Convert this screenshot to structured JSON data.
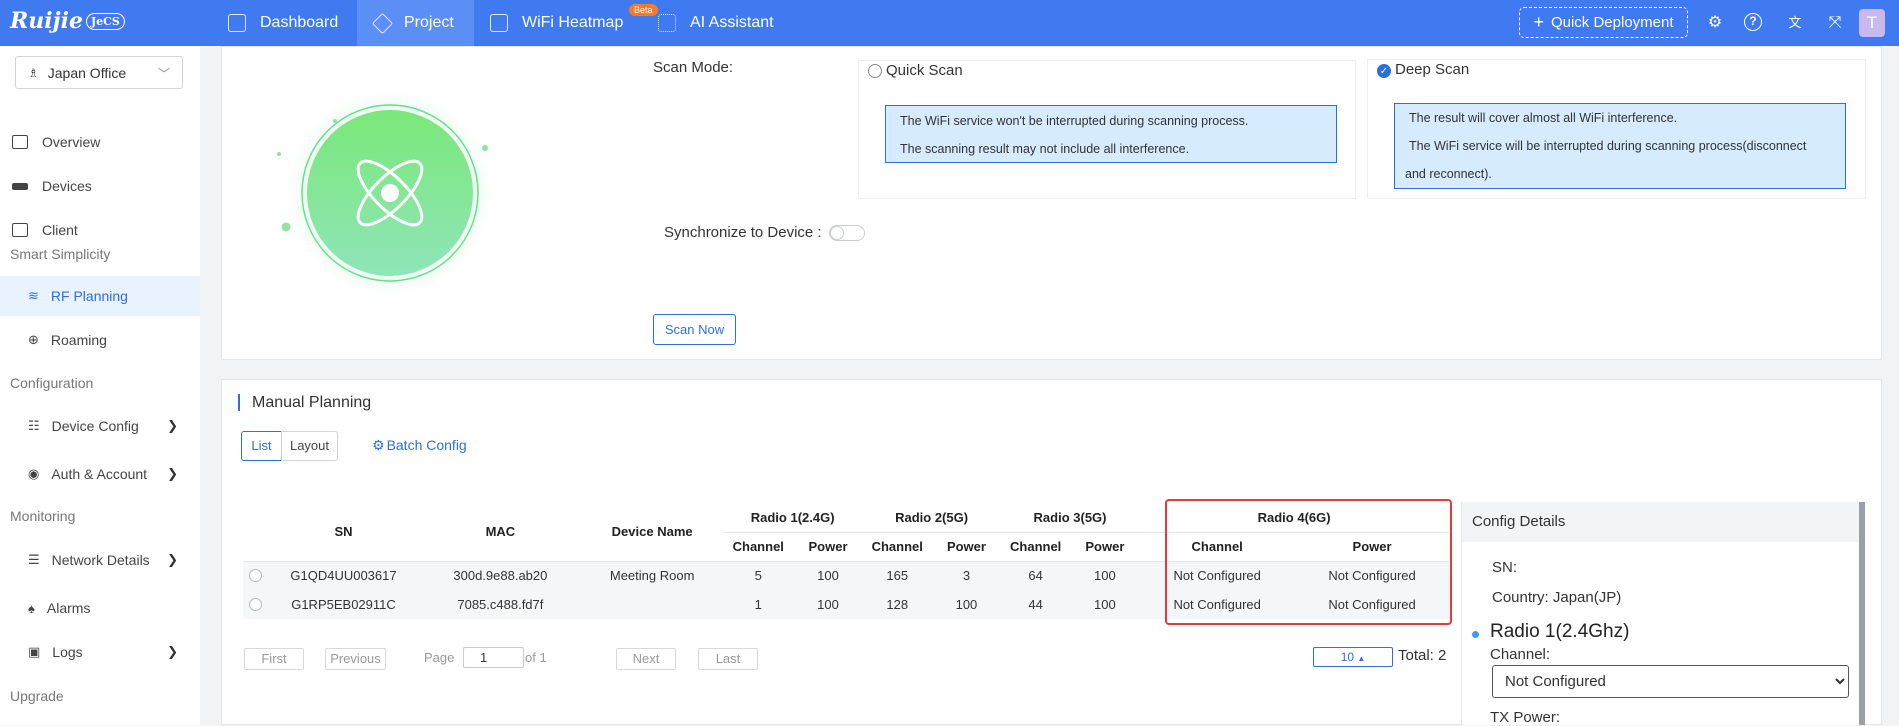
{
  "brand": {
    "name": "Ruijie",
    "cloud": "JeCS"
  },
  "nav": {
    "dashboard": "Dashboard",
    "project": "Project",
    "wifi_heatmap": "WiFi Heatmap",
    "beta": "Beta",
    "ai_assistant": "AI Assistant",
    "quick_deployment": "Quick Deployment",
    "avatar": "T"
  },
  "sidebar": {
    "site": "Japan Office",
    "items": {
      "overview": "Overview",
      "devices": "Devices",
      "client": "Client",
      "rf_planning": "RF Planning",
      "roaming": "Roaming",
      "device_config": "Device Config",
      "auth_account": "Auth & Account",
      "network_details": "Network Details",
      "alarms": "Alarms",
      "logs": "Logs"
    },
    "groups": {
      "smart_simplicity": "Smart Simplicity",
      "configuration": "Configuration",
      "monitoring": "Monitoring",
      "upgrade": "Upgrade"
    }
  },
  "scan": {
    "mode_label": "Scan Mode:",
    "quick_label": "Quick Scan",
    "quick_info1": "The WiFi service won't be interrupted during scanning process.",
    "quick_info2": "The scanning result may not include all interference.",
    "deep_label": "Deep Scan",
    "deep_info1": "The result will cover almost all WiFi interference.",
    "deep_info2": "The WiFi service will be interrupted during scanning process(disconnect",
    "deep_info3": "and reconnect).",
    "sync_label": "Synchronize to Device :",
    "scan_now": "Scan Now",
    "selected_mode": "deep",
    "sync_enabled": false
  },
  "manual": {
    "title": "Manual Planning",
    "tab_list": "List",
    "tab_layout": "Layout",
    "batch_config": "Batch Config"
  },
  "table": {
    "headers": {
      "sn": "SN",
      "mac": "MAC",
      "device_name": "Device Name",
      "radio1": "Radio 1(2.4G)",
      "radio2": "Radio 2(5G)",
      "radio3": "Radio 3(5G)",
      "radio4": "Radio 4(6G)",
      "channel": "Channel",
      "power": "Power"
    },
    "rows": [
      {
        "sn": "G1QD4UU003617",
        "mac": "300d.9e88.ab20",
        "name": "Meeting Room",
        "r1c": "5",
        "r1p": "100",
        "r2c": "165",
        "r2p": "3",
        "r3c": "64",
        "r3p": "100",
        "r4c": "Not Configured",
        "r4p": "Not Configured"
      },
      {
        "sn": "G1RP5EB02911C",
        "mac": "7085.c488.fd7f",
        "name": "",
        "r1c": "1",
        "r1p": "100",
        "r2c": "128",
        "r2p": "100",
        "r3c": "44",
        "r3p": "100",
        "r4c": "Not Configured",
        "r4p": "Not Configured"
      }
    ]
  },
  "pagination": {
    "first": "First",
    "previous": "Previous",
    "page_label": "Page",
    "page_value": "1",
    "of": "of 1",
    "next": "Next",
    "last": "Last",
    "page_size": "10",
    "total": "Total: 2"
  },
  "config_details": {
    "title": "Config Details",
    "sn_label": "SN:",
    "country": "Country: Japan(JP)",
    "radio1": "Radio 1(2.4Ghz)",
    "channel_label": "Channel:",
    "channel_value": "Not Configured",
    "tx_power_label": "TX Power:"
  },
  "colors": {
    "brand_blue": "#3f7af0",
    "accent": "#2d6fdf",
    "highlight_red": "#e33b3b",
    "scan_green": "#5fe38a"
  }
}
